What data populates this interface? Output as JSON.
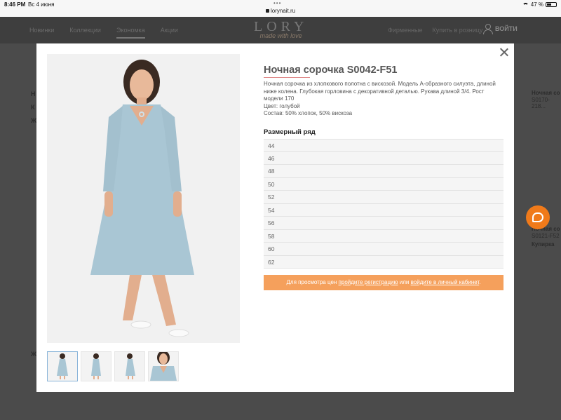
{
  "status_bar": {
    "time": "8:46 PM",
    "date": "Вс 4 июня",
    "url": "lorynait.ru",
    "battery": "47 %"
  },
  "header": {
    "nav": [
      "Новинки",
      "Коллекции",
      "Экономка",
      "Акции"
    ],
    "logo_title": "LORY",
    "logo_tagline": "made with love",
    "right_links": [
      "Фирменные",
      "Купить в розницу"
    ],
    "login_label": "ВОЙТИ"
  },
  "background": {
    "right_items": [
      "Ночная со",
      "S0170-218...",
      "Ночная со",
      "S0121-F52",
      "Купирка"
    ],
    "left_chars": [
      "Н",
      "К",
      "Ж",
      "Ж"
    ]
  },
  "product": {
    "title": "Ночная сорочка S0042-F51",
    "description_lines": [
      "Ночная сорочка из хлопкового полотна с вискозой. Модель А-образного силуэта, длиной",
      "ниже колена. Глубокая горловина с декоративной деталью. Рукава длиной 3/4. Рост",
      "модели 170",
      "Цвет: голубой",
      "Состав: 50% хлопок, 50% вискоза"
    ],
    "size_heading": "Размерный ряд",
    "sizes": [
      "44",
      "46",
      "48",
      "50",
      "52",
      "54",
      "56",
      "58",
      "60",
      "62"
    ],
    "notice_prefix": "Для просмотра цен ",
    "notice_link1": "пройдите регистрацию",
    "notice_middle": " или ",
    "notice_link2": "войдите в личный кабинет",
    "notice_suffix": ".",
    "dress_color": "#a9c6d4",
    "accent_color": "#f5a05c"
  }
}
